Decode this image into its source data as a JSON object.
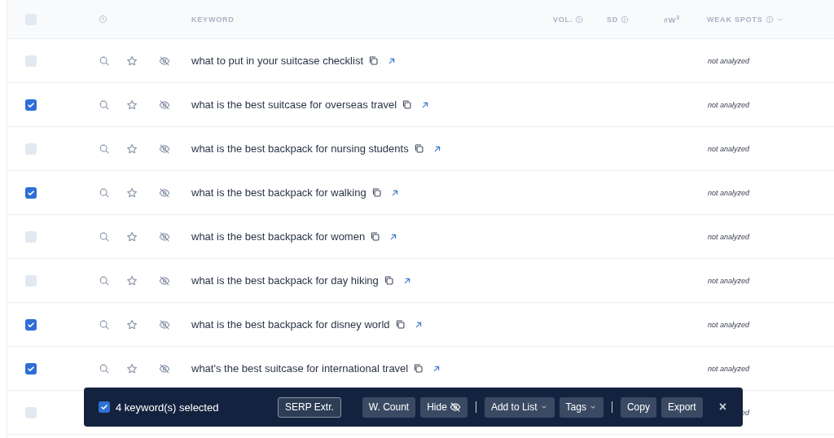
{
  "table": {
    "header": {
      "checked": false,
      "columns": [
        {
          "label": "KEYWORD",
          "kind": "text"
        },
        {
          "label": "VOL.",
          "kind": "info"
        },
        {
          "label": "SD",
          "kind": "info"
        },
        {
          "label": "#W$^{3}$",
          "kind": "text"
        },
        {
          "label": "WEAK SPOTS",
          "kind": "info-sort"
        }
      ]
    },
    "rows": [
      {
        "checked": false,
        "keyword": "what to put in your suitcase checklist",
        "weak_spots": "not analyzed"
      },
      {
        "checked": true,
        "keyword": "what is the best suitcase for overseas travel",
        "weak_spots": "not analyzed"
      },
      {
        "checked": false,
        "keyword": "what is the best backpack for nursing students",
        "weak_spots": "not analyzed"
      },
      {
        "checked": true,
        "keyword": "what is the best backpack for walking",
        "weak_spots": "not analyzed"
      },
      {
        "checked": false,
        "keyword": "what is the best backpack for women",
        "weak_spots": "not analyzed"
      },
      {
        "checked": false,
        "keyword": "what is the best backpack for day hiking",
        "weak_spots": "not analyzed"
      },
      {
        "checked": true,
        "keyword": "what is the best backpack for disney world",
        "weak_spots": "not analyzed"
      },
      {
        "checked": true,
        "keyword": "what's the best suitcase for international travel",
        "weak_spots": "not analyzed"
      },
      {
        "checked": false,
        "weak_spots": "ed"
      }
    ]
  },
  "selection_bar": {
    "checked": true,
    "label": "4 keyword(s) selected",
    "buttons": [
      {
        "label": "SERP Extr.",
        "kind": "outline"
      },
      {
        "label": "W. Count",
        "kind": "plain"
      },
      {
        "label": "Hide",
        "kind": "hide"
      },
      {
        "kind": "separator"
      },
      {
        "label": "Add to List",
        "kind": "dropdown"
      },
      {
        "label": "Tags",
        "kind": "dropdown"
      },
      {
        "kind": "separator"
      },
      {
        "label": "Copy",
        "kind": "plain"
      },
      {
        "label": "Export",
        "kind": "plain"
      },
      {
        "label": "×",
        "kind": "close"
      }
    ]
  }
}
